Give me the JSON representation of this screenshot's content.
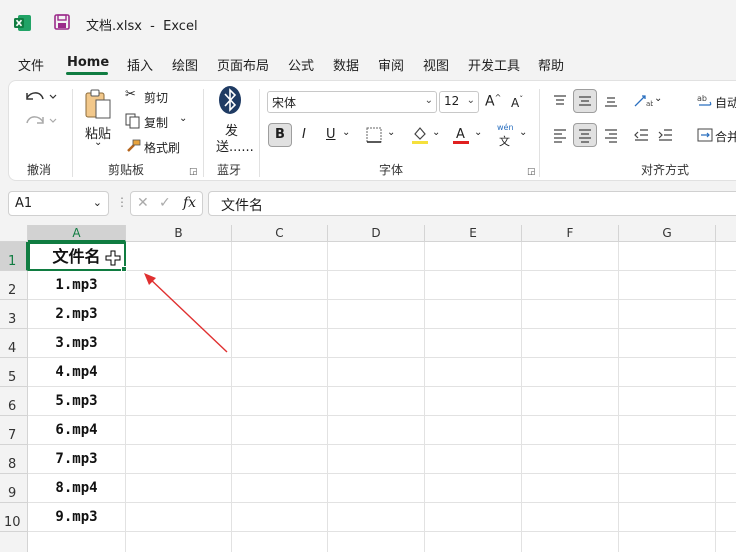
{
  "window": {
    "title": "文档.xlsx  -  Excel"
  },
  "menu": {
    "tabs": [
      "文件",
      "Home",
      "插入",
      "绘图",
      "页面布局",
      "公式",
      "数据",
      "审阅",
      "视图",
      "开发工具",
      "帮助"
    ],
    "active": "Home"
  },
  "ribbon": {
    "undo_group": {
      "label": "撤消"
    },
    "clipboard": {
      "label": "剪贴板",
      "paste": "粘贴",
      "cut": "剪切",
      "copy": "复制",
      "format_painter": "格式刷"
    },
    "bluetooth": {
      "label": "蓝牙",
      "send_line1": "发",
      "send_line2": "送......"
    },
    "font": {
      "label": "字体",
      "font_name": "宋体",
      "font_size": "12",
      "bold": "B",
      "italic": "I",
      "underline": "U",
      "wen_top": "wén",
      "wen_bottom": "文"
    },
    "alignment": {
      "label": "对齐方式",
      "wrap": "自动",
      "merge": "合并"
    }
  },
  "formula_bar": {
    "name_box": "A1",
    "content": "文件名",
    "fx": "fx"
  },
  "sheet": {
    "columns": [
      "A",
      "B",
      "C",
      "D",
      "E",
      "F",
      "G"
    ],
    "rows": [
      "1",
      "2",
      "3",
      "4",
      "5",
      "6",
      "7",
      "8",
      "9",
      "10"
    ],
    "column_a": [
      "文件名",
      "1.mp3",
      "2.mp3",
      "3.mp3",
      "4.mp4",
      "5.mp3",
      "6.mp4",
      "7.mp3",
      "8.mp4",
      "9.mp3"
    ],
    "selected_cell": "A1"
  },
  "colors": {
    "accent": "#107c41",
    "arrow": "#e03030"
  }
}
